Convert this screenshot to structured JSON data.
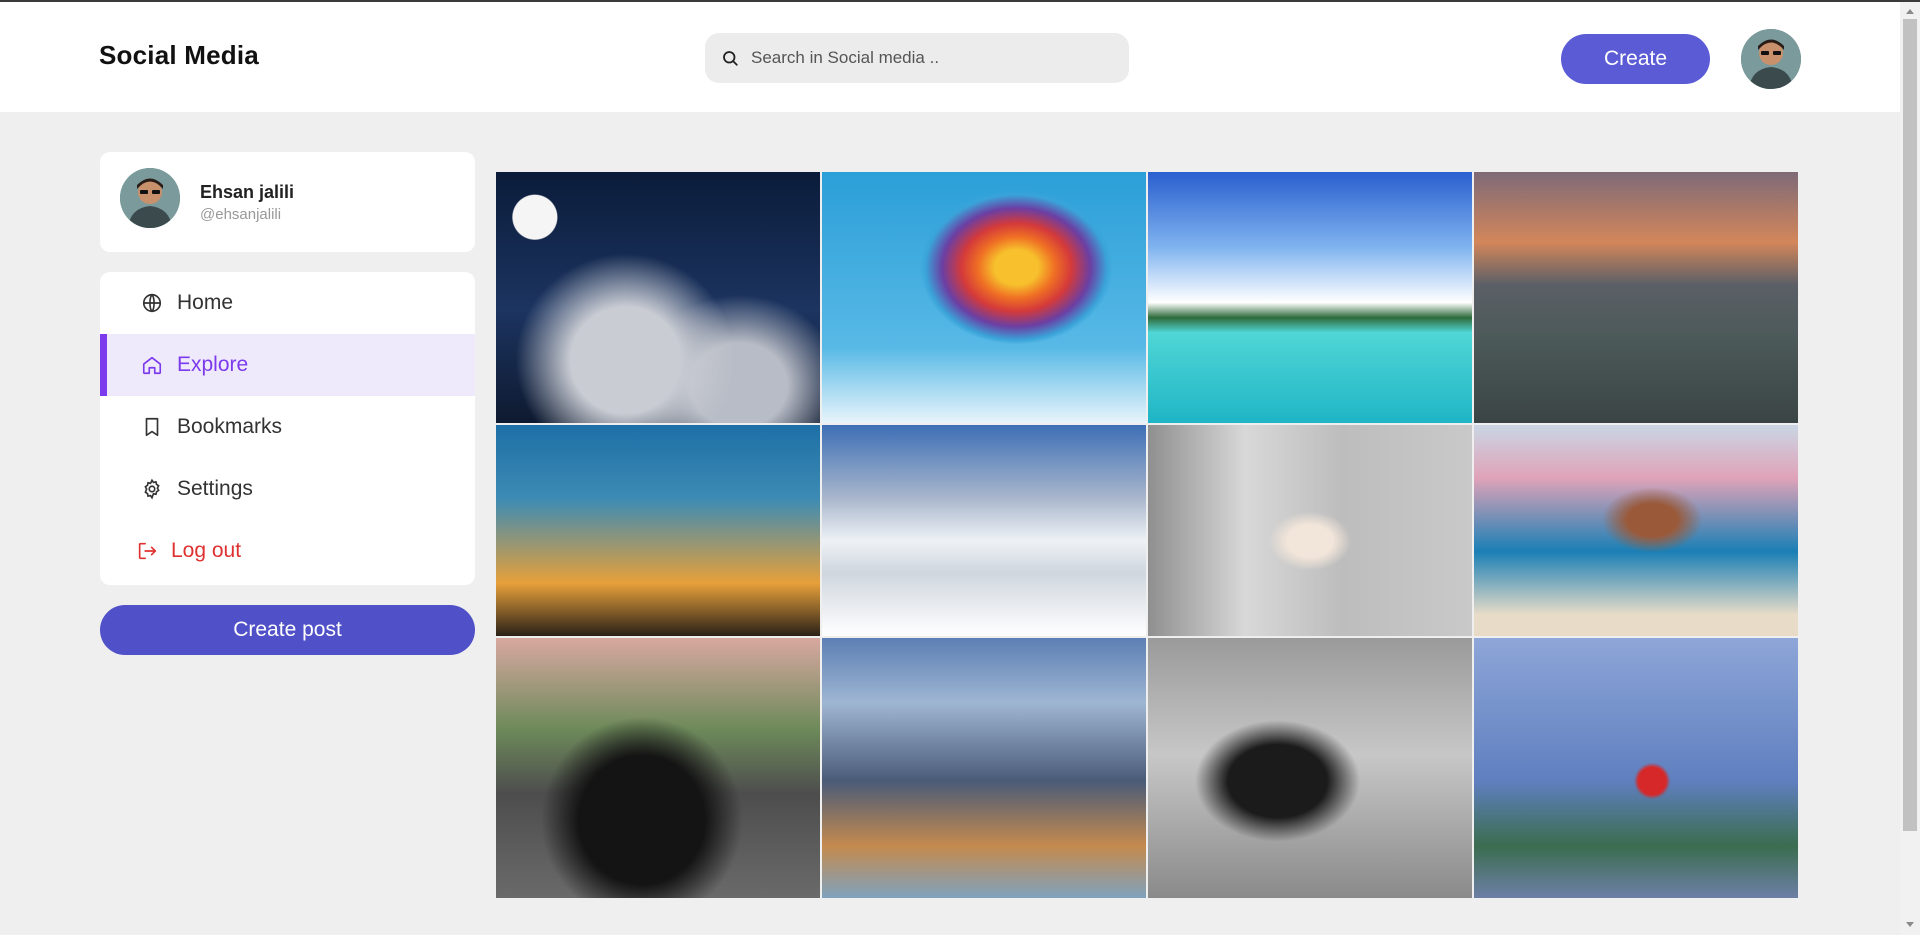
{
  "brand": "Social Media",
  "search": {
    "placeholder": "Search in Social media .."
  },
  "header": {
    "create_label": "Create"
  },
  "profile": {
    "name": "Ehsan jalili",
    "handle": "@ehsanjalili"
  },
  "sidebar": {
    "items": [
      {
        "label": "Home",
        "icon": "globe-icon"
      },
      {
        "label": "Explore",
        "icon": "home-icon",
        "active": true
      },
      {
        "label": "Bookmarks",
        "icon": "bookmark-icon"
      },
      {
        "label": "Settings",
        "icon": "gear-icon"
      },
      {
        "label": "Log out",
        "icon": "logout-icon"
      }
    ],
    "create_post_label": "Create post"
  },
  "gallery": {
    "images": [
      "night-sky-moon-clouds",
      "hot-air-balloon",
      "tropical-island",
      "sunset-rocky-coast",
      "bridge-sunset",
      "smartphone-closeup",
      "woman-portrait",
      "horses-beach",
      "black-muscle-car",
      "city-skyline",
      "motocross-jump",
      "vintage-airplane"
    ]
  },
  "colors": {
    "accent": "#5b5bd6",
    "active": "#7c3aed",
    "active_bg": "#efe9fc",
    "logout": "#e03131",
    "background": "#efefef"
  }
}
